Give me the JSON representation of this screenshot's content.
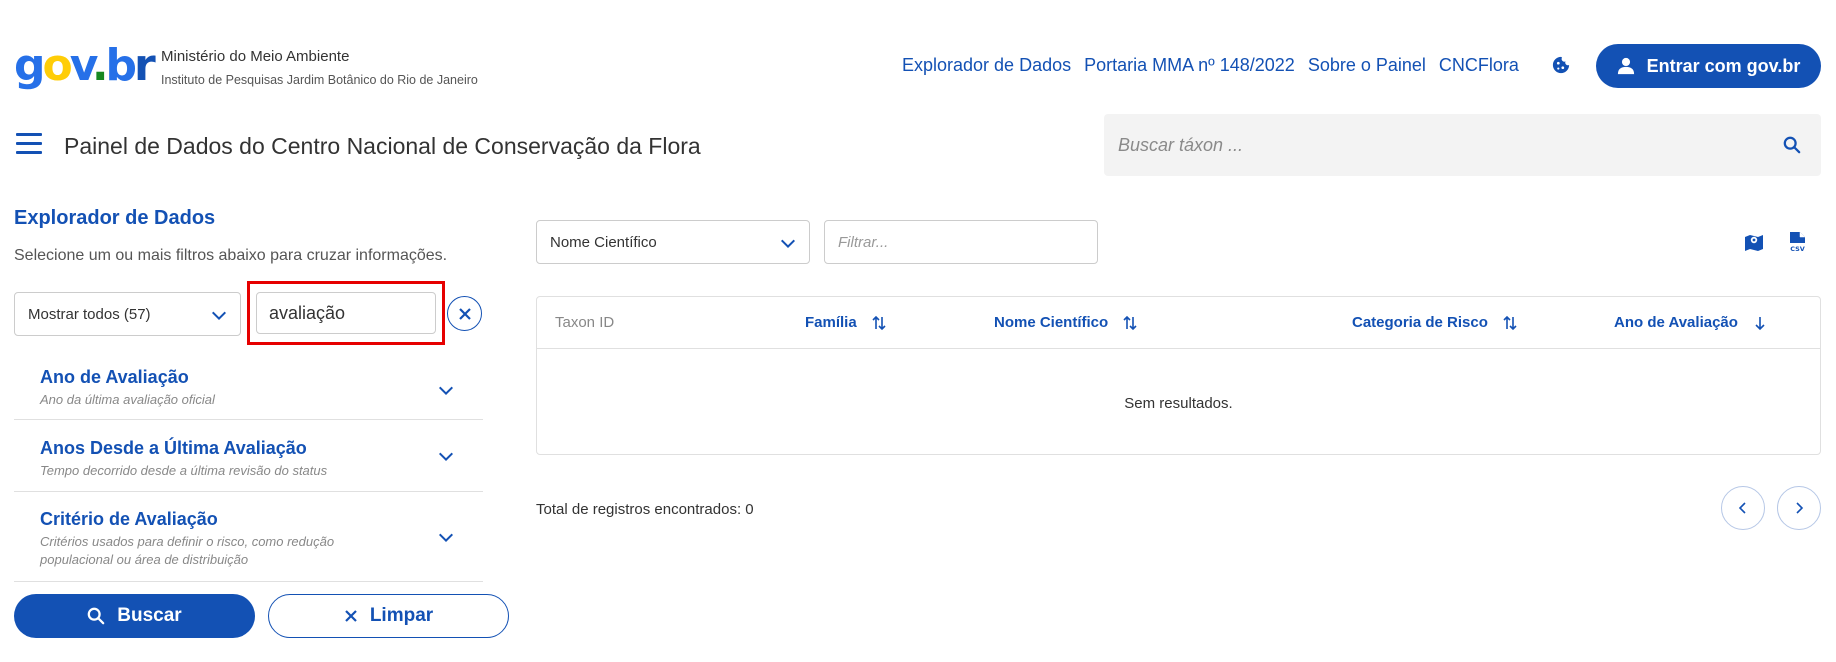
{
  "logo": {
    "text": "gov.br"
  },
  "org": {
    "line1": "Ministério do Meio Ambiente",
    "line2": "Instituto de Pesquisas Jardim Botânico do Rio de Janeiro"
  },
  "topnav": {
    "items": [
      "Explorador de Dados",
      "Portaria MMA nº 148/2022",
      "Sobre o Painel",
      "CNCFlora"
    ]
  },
  "login": {
    "label": "Entrar com gov.br"
  },
  "site": {
    "title": "Painel de Dados do Centro Nacional de Conservação da Flora"
  },
  "search": {
    "placeholder": "Buscar táxon ..."
  },
  "explorer": {
    "title": "Explorador de Dados",
    "subtitle": "Selecione um ou mais filtros abaixo para cruzar informações.",
    "show_select": "Mostrar todos (57)",
    "filter_value": "avaliação",
    "accordions": [
      {
        "title": "Ano de Avaliação",
        "desc": "Ano da última avaliação oficial"
      },
      {
        "title": "Anos Desde a Última Avaliação",
        "desc": "Tempo decorrido desde a última revisão do status"
      },
      {
        "title": "Critério de Avaliação",
        "desc": "Critérios usados para definir o risco, como redução populacional ou área de distribuição"
      }
    ],
    "search_button": "Buscar",
    "clear_button": "Limpar"
  },
  "results": {
    "column_select": "Nome Científico",
    "filter_placeholder": "Filtrar...",
    "columns": [
      "Taxon ID",
      "Família",
      "Nome Científico",
      "Categoria de Risco",
      "Ano de Avaliação"
    ],
    "empty_text": "Sem resultados.",
    "total_text": "Total de registros encontrados: 0"
  },
  "colors": {
    "primary": "#1351b4",
    "highlight": "#e60000"
  },
  "icons": [
    "cookie-icon",
    "user-icon",
    "menu-icon",
    "search-icon",
    "chevron-down-icon",
    "close-icon",
    "map-icon",
    "csv-icon",
    "sort-icon",
    "arrow-down-icon",
    "chevron-left-icon",
    "chevron-right-icon"
  ]
}
